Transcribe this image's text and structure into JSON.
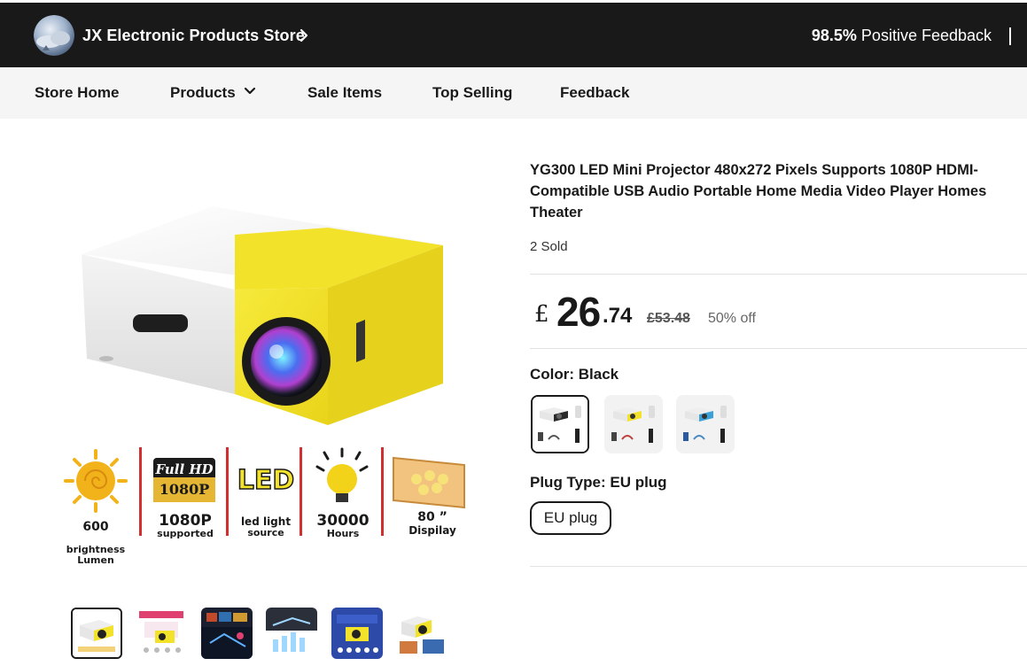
{
  "store": {
    "name": "JX Electronic Products Store",
    "feedback_percent": "98.5%",
    "feedback_label": "Positive Feedback"
  },
  "nav": {
    "items": [
      {
        "label": "Store Home"
      },
      {
        "label": "Products"
      },
      {
        "label": "Sale Items"
      },
      {
        "label": "Top Selling"
      },
      {
        "label": "Feedback"
      }
    ]
  },
  "product": {
    "title": "YG300 LED Mini Projector 480x272 Pixels Supports 1080P HDMI-Compatible USB Audio Portable Home Media Video Player Homes Theater",
    "sold": "2 Sold",
    "price": {
      "currency": "£",
      "integer": "26",
      "decimal": ".74",
      "original": "£53.48",
      "discount": "50% off"
    },
    "color": {
      "label": "Color: Black",
      "selected_index": 0,
      "options": [
        "black",
        "yellow",
        "blue"
      ]
    },
    "plug": {
      "label": "Plug Type: EU plug",
      "option": "EU plug"
    }
  },
  "gallery": {
    "features": [
      {
        "top": "600",
        "bottom": "brightness\nLumen"
      },
      {
        "top": "1080P",
        "bottom": "supported"
      },
      {
        "top": "led light",
        "bottom": "source"
      },
      {
        "top": "30000",
        "bottom": "Hours"
      },
      {
        "top": "80 ”",
        "bottom": "Dispilay"
      }
    ],
    "badge_full": "Full HD",
    "badge_1080": "1080P",
    "badge_led": "LED",
    "thumbnail_count": 6,
    "selected_thumbnail": 0
  },
  "colors": {
    "header_bg": "#191919",
    "nav_bg": "#f5f5f5",
    "projector_yellow": "#f3e22a",
    "accent_orange": "#e8a02a"
  }
}
